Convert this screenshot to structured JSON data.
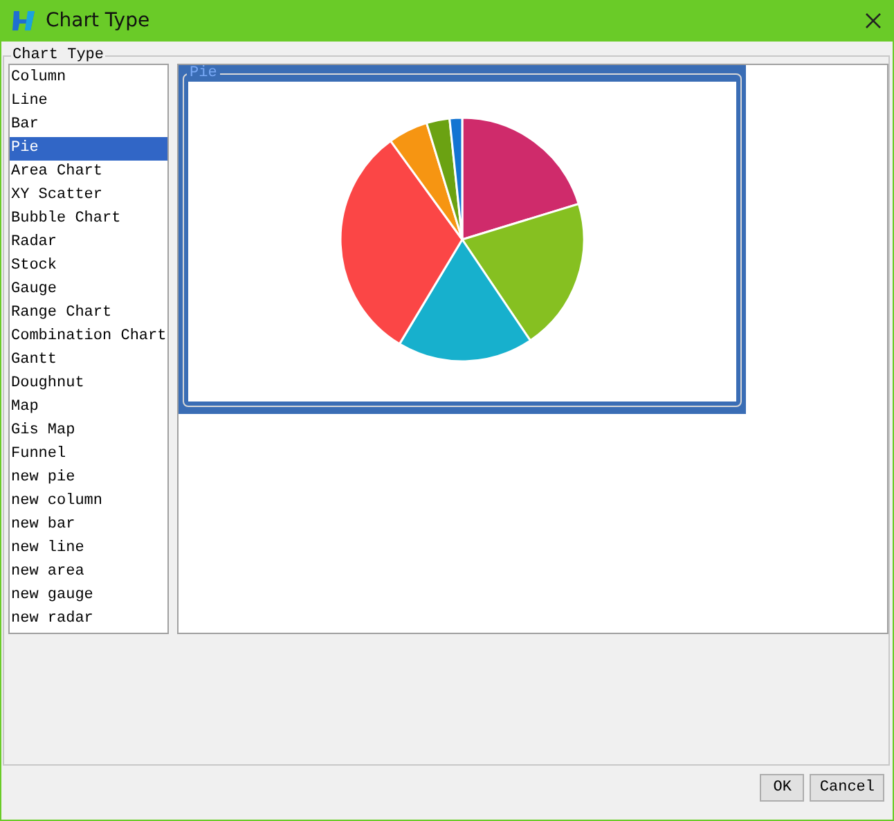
{
  "window": {
    "title": "Chart Type"
  },
  "group": {
    "label": "Chart Type"
  },
  "chart_types": [
    {
      "label": "Column",
      "selected": false
    },
    {
      "label": "Line",
      "selected": false
    },
    {
      "label": "Bar",
      "selected": false
    },
    {
      "label": "Pie",
      "selected": true
    },
    {
      "label": "Area Chart",
      "selected": false
    },
    {
      "label": "XY Scatter",
      "selected": false
    },
    {
      "label": "Bubble Chart",
      "selected": false
    },
    {
      "label": "Radar",
      "selected": false
    },
    {
      "label": "Stock",
      "selected": false
    },
    {
      "label": "Gauge",
      "selected": false
    },
    {
      "label": "Range Chart",
      "selected": false
    },
    {
      "label": "Combination Chart",
      "selected": false
    },
    {
      "label": "Gantt",
      "selected": false
    },
    {
      "label": "Doughnut",
      "selected": false
    },
    {
      "label": "Map",
      "selected": false
    },
    {
      "label": "Gis Map",
      "selected": false
    },
    {
      "label": "Funnel",
      "selected": false
    },
    {
      "label": "new pie",
      "selected": false
    },
    {
      "label": "new column",
      "selected": false
    },
    {
      "label": "new bar",
      "selected": false
    },
    {
      "label": "new line",
      "selected": false
    },
    {
      "label": "new area",
      "selected": false
    },
    {
      "label": "new gauge",
      "selected": false
    },
    {
      "label": "new radar",
      "selected": false
    }
  ],
  "preview": {
    "title": "Pie"
  },
  "buttons": [
    "OK",
    "Cancel"
  ]
}
